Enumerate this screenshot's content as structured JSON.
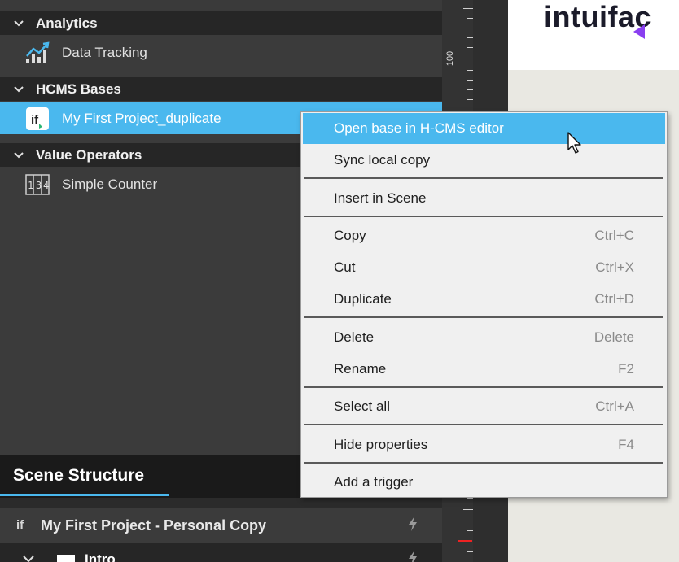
{
  "sidebar": {
    "sections": [
      {
        "title": "Analytics",
        "items": [
          {
            "label": "Data Tracking",
            "icon": "chart-icon"
          }
        ]
      },
      {
        "title": "HCMS Bases",
        "items": [
          {
            "label": "My First Project_duplicate",
            "icon": "intuiface-logo-icon",
            "selected": true
          }
        ]
      },
      {
        "title": "Value Operators",
        "items": [
          {
            "label": "Simple Counter",
            "icon": "counter-icon"
          }
        ]
      }
    ]
  },
  "ruler": {
    "label": "100"
  },
  "canvas": {
    "logo_text": "intuifac"
  },
  "scene_structure": {
    "tab_label": "Scene Structure",
    "project_label": "My First Project - Personal Copy",
    "intro_label": "Intro"
  },
  "context_menu": {
    "items": [
      {
        "label": "Open base in H-CMS editor",
        "shortcut": ""
      },
      {
        "label": "Sync local copy",
        "shortcut": ""
      },
      {
        "label": "Insert in Scene",
        "shortcut": ""
      },
      {
        "label": "Copy",
        "shortcut": "Ctrl+C"
      },
      {
        "label": "Cut",
        "shortcut": "Ctrl+X"
      },
      {
        "label": "Duplicate",
        "shortcut": "Ctrl+D"
      },
      {
        "label": "Delete",
        "shortcut": "Delete"
      },
      {
        "label": "Rename",
        "shortcut": "F2"
      },
      {
        "label": "Select all",
        "shortcut": "Ctrl+A"
      },
      {
        "label": "Hide properties",
        "shortcut": "F4"
      },
      {
        "label": "Add a trigger",
        "shortcut": ""
      }
    ]
  },
  "colors": {
    "accent": "#4ab8ee",
    "panel": "#3b3b3b",
    "header": "#262626",
    "menu_bg": "#f0f0f0",
    "logo_accent": "#8a3ff0"
  }
}
